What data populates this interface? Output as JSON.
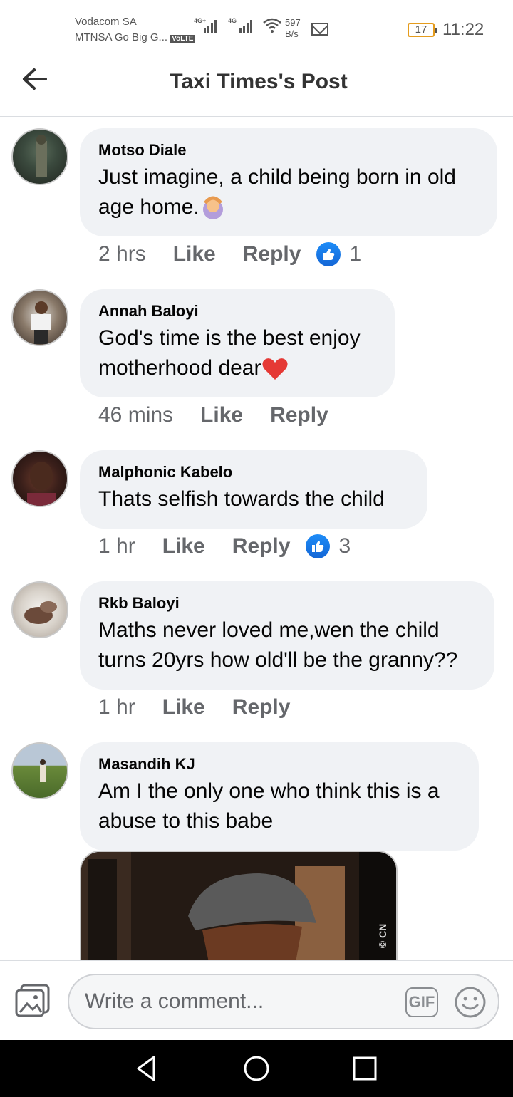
{
  "status": {
    "carrier1": "Vodacom SA",
    "carrier2": "MTNSA Go Big G...",
    "volte": "VoLTE",
    "net1": "4G+",
    "net2": "4G",
    "speed_value": "597",
    "speed_unit": "B/s",
    "battery": "17",
    "time": "11:22"
  },
  "header": {
    "title": "Taxi Times's Post"
  },
  "comments": [
    {
      "author": "Motso Diale",
      "text": "Just imagine, a child being born in old age home.",
      "time": "2 hrs",
      "like": "Like",
      "reply": "Reply",
      "reactions": "1"
    },
    {
      "author": "Annah Baloyi",
      "text": "God's time is the best enjoy motherhood dear",
      "time": "46 mins",
      "like": "Like",
      "reply": "Reply"
    },
    {
      "author": "Malphonic Kabelo",
      "text": "Thats selfish towards the child",
      "time": "1 hr",
      "like": "Like",
      "reply": "Reply",
      "reactions": "3"
    },
    {
      "author": "Rkb Baloyi",
      "text": "Maths never loved me,wen the child turns 20yrs how old'll be the granny??",
      "time": "1 hr",
      "like": "Like",
      "reply": "Reply"
    },
    {
      "author": "Masandih KJ",
      "text": "Am I the only one who think this is a abuse to this babe"
    }
  ],
  "attachment": {
    "watermark": "© CN"
  },
  "composer": {
    "placeholder": "Write a comment...",
    "gif_label": "GIF"
  },
  "colors": {
    "like_blue": "#1877f2",
    "bubble_bg": "#f0f2f5",
    "meta_grey": "#65676b"
  }
}
